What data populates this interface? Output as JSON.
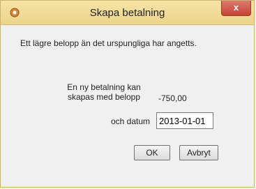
{
  "window": {
    "title": "Skapa betalning",
    "close_label": "x"
  },
  "message": "Ett lägre belopp än det urspungliga har angetts.",
  "new_payment": {
    "label": "En ny betalning kan skapas med belopp",
    "amount": "-750,00"
  },
  "date": {
    "label": "och datum",
    "value": "2013-01-01"
  },
  "buttons": {
    "ok": "OK",
    "cancel": "Avbryt"
  },
  "colors": {
    "titlebar": "#ecd48a",
    "close": "#c44334"
  },
  "icons": {
    "app": "app-icon",
    "close": "close-icon"
  }
}
